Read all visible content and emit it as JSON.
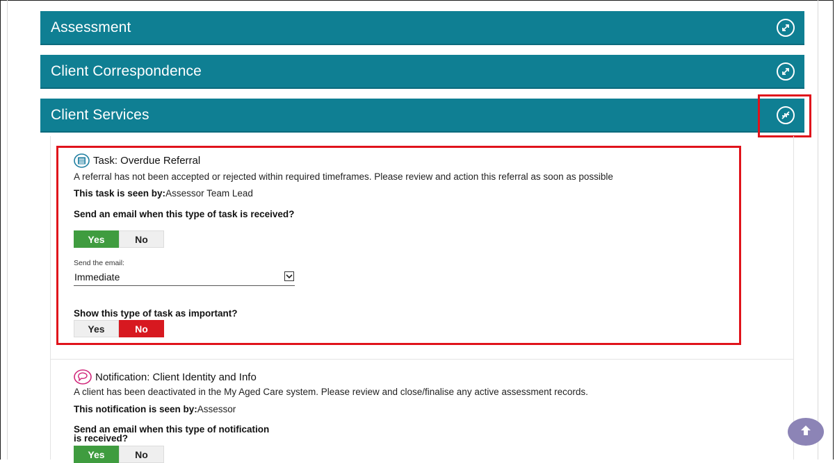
{
  "panels": [
    {
      "title": "Assessment",
      "toggle_icon": "expand-icon"
    },
    {
      "title": "Client Correspondence",
      "toggle_icon": "expand-icon"
    },
    {
      "title": "Client Services",
      "toggle_icon": "collapse-icon"
    }
  ],
  "colors": {
    "header_bg": "#0f7f93",
    "highlight": "#e0131b",
    "yes_active": "#3f9c3f",
    "no_active": "#d71920",
    "scroll_button": "#8c84b6"
  },
  "task": {
    "icon": "task-icon",
    "title": "Task: Overdue Referral",
    "description": "A referral has not been accepted or rejected within required timeframes. Please review and action this referral as soon as possible",
    "seen_by_label": "This task is seen by:",
    "seen_by_value": "Assessor Team Lead",
    "email_question": "Send an email when this type of task is received?",
    "email_yes": "Yes",
    "email_no": "No",
    "email_selected": "Yes",
    "send_label": "Send the email:",
    "send_value": "Immediate",
    "important_question": "Show this type of task as important?",
    "important_yes": "Yes",
    "important_no": "No",
    "important_selected": "No"
  },
  "notification": {
    "icon": "speech-bubble-icon",
    "title": "Notification: Client Identity and Info",
    "description": "A client has been deactivated in the My Aged Care system. Please review and close/finalise any active assessment records.",
    "seen_by_label": "This notification is seen by:",
    "seen_by_value": "Assessor",
    "email_question": "Send an email when this type of notification is received?",
    "email_yes": "Yes",
    "email_no": "No",
    "email_selected": "Yes"
  },
  "scroll_top_icon": "arrow-up-icon"
}
